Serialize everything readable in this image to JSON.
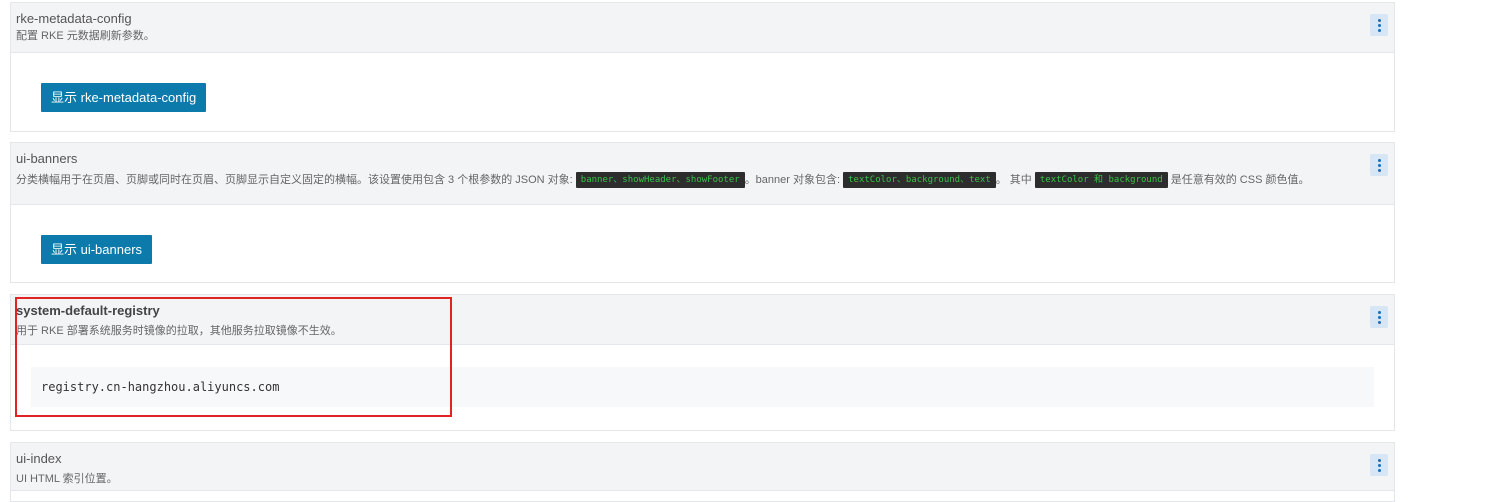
{
  "settings": [
    {
      "title": "rke-metadata-config",
      "desc": "配置 RKE 元数据刷新参数。",
      "button_label": "显示 rke-metadata-config"
    },
    {
      "title": "ui-banners",
      "desc_part1": "分类横幅用于在页眉、页脚或同时在页眉、页脚显示自定义固定的横幅。该设置使用包含 3 个根参数的 JSON 对象:",
      "tag1": "banner、showHeader、showFooter",
      "desc_part2": "。banner 对象包含:",
      "tag2": "textColor、background、text",
      "desc_part3": "。 其中",
      "tag3": "textColor 和 background",
      "desc_part4": "是任意有效的 CSS 颜色值。",
      "button_label": "显示 ui-banners"
    },
    {
      "title": "system-default-registry",
      "desc": "用于 RKE 部署系统服务时镜像的拉取，其他服务拉取镜像不生效。",
      "value": "registry.cn-hangzhou.aliyuncs.com"
    },
    {
      "title": "ui-index",
      "desc": "UI HTML 索引位置。"
    }
  ],
  "highlight_color": "#e02424",
  "accent_color": "#0c7bab"
}
